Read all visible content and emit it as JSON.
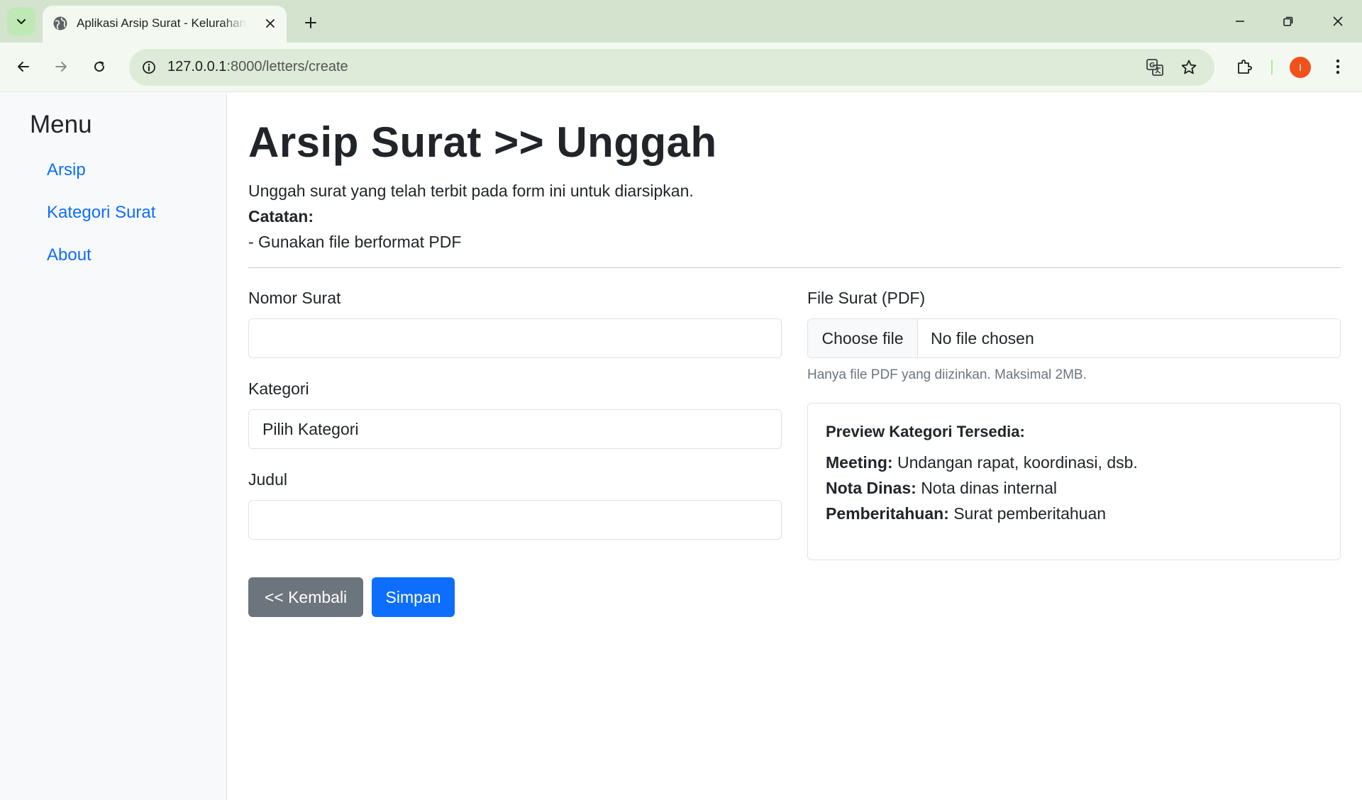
{
  "browser": {
    "tab_title": "Aplikasi Arsip Surat - Kelurahan",
    "url_host": "127.0.0.1",
    "url_path": ":8000/letters/create",
    "profile_initial": "I"
  },
  "sidebar": {
    "title": "Menu",
    "items": [
      {
        "label": "Arsip"
      },
      {
        "label": "Kategori Surat"
      },
      {
        "label": "About"
      }
    ]
  },
  "main": {
    "title": "Arsip Surat >> Unggah",
    "description": "Unggah surat yang telah terbit pada form ini untuk diarsipkan.",
    "note_label": "Catatan:",
    "note_item": "- Gunakan file berformat PDF"
  },
  "form": {
    "nomor_label": "Nomor Surat",
    "nomor_value": "",
    "kategori_label": "Kategori",
    "kategori_selected": "Pilih Kategori",
    "judul_label": "Judul",
    "judul_value": "",
    "file_label": "File Surat (PDF)",
    "file_button": "Choose file",
    "file_status": "No file chosen",
    "file_help": "Hanya file PDF yang diizinkan. Maksimal 2MB."
  },
  "preview": {
    "title": "Preview Kategori Tersedia:",
    "items": [
      {
        "name": "Meeting:",
        "desc": "Undangan rapat, koordinasi, dsb."
      },
      {
        "name": "Nota Dinas:",
        "desc": "Nota dinas internal"
      },
      {
        "name": "Pemberitahuan:",
        "desc": "Surat pemberitahuan"
      }
    ]
  },
  "buttons": {
    "back_label": "<< Kembali",
    "save_label": "Simpan"
  },
  "colors": {
    "primary": "#0d6efd",
    "secondary": "#6c757d",
    "tabstrip": "#d3e3cd",
    "avatar": "#f1511b"
  }
}
